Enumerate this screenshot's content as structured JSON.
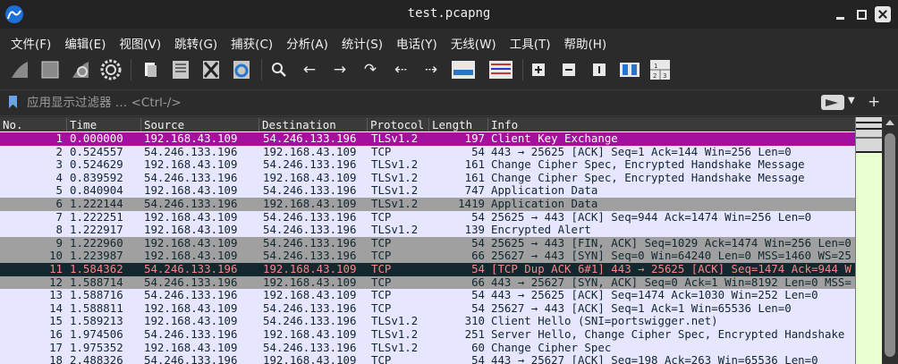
{
  "window": {
    "title": "test.pcapng"
  },
  "menu": [
    "文件(F)",
    "编辑(E)",
    "视图(V)",
    "跳转(G)",
    "捕获(C)",
    "分析(A)",
    "统计(S)",
    "电话(Y)",
    "无线(W)",
    "工具(T)",
    "帮助(H)"
  ],
  "filter": {
    "placeholder": "应用显示过滤器 … <Ctrl-/>"
  },
  "columns": [
    "No.",
    "Time",
    "Source",
    "Destination",
    "Protocol",
    "Length",
    "Info"
  ],
  "packets": [
    {
      "no": "1",
      "time": "0.000000",
      "src": "192.168.43.109",
      "dst": "54.246.133.196",
      "proto": "TLSv1.2",
      "len": "197",
      "info": "Client Key Exchange",
      "style": "sel"
    },
    {
      "no": "2",
      "time": "0.524557",
      "src": "54.246.133.196",
      "dst": "192.168.43.109",
      "proto": "TCP",
      "len": "54",
      "info": "443 → 25625 [ACK] Seq=1 Ack=144 Win=256 Len=0",
      "style": "tcp"
    },
    {
      "no": "3",
      "time": "0.524629",
      "src": "192.168.43.109",
      "dst": "54.246.133.196",
      "proto": "TLSv1.2",
      "len": "161",
      "info": "Change Cipher Spec, Encrypted Handshake Message",
      "style": "tls"
    },
    {
      "no": "4",
      "time": "0.839592",
      "src": "54.246.133.196",
      "dst": "192.168.43.109",
      "proto": "TLSv1.2",
      "len": "161",
      "info": "Change Cipher Spec, Encrypted Handshake Message",
      "style": "tls"
    },
    {
      "no": "5",
      "time": "0.840904",
      "src": "192.168.43.109",
      "dst": "54.246.133.196",
      "proto": "TLSv1.2",
      "len": "747",
      "info": "Application Data",
      "style": "tls"
    },
    {
      "no": "6",
      "time": "1.222144",
      "src": "54.246.133.196",
      "dst": "192.168.43.109",
      "proto": "TLSv1.2",
      "len": "1419",
      "info": "Application Data",
      "style": "gray"
    },
    {
      "no": "7",
      "time": "1.222251",
      "src": "192.168.43.109",
      "dst": "54.246.133.196",
      "proto": "TCP",
      "len": "54",
      "info": "25625 → 443 [ACK] Seq=944 Ack=1474 Win=256 Len=0",
      "style": "tcp"
    },
    {
      "no": "8",
      "time": "1.222917",
      "src": "192.168.43.109",
      "dst": "54.246.133.196",
      "proto": "TLSv1.2",
      "len": "139",
      "info": "Encrypted Alert",
      "style": "tls"
    },
    {
      "no": "9",
      "time": "1.222960",
      "src": "192.168.43.109",
      "dst": "54.246.133.196",
      "proto": "TCP",
      "len": "54",
      "info": "25625 → 443 [FIN, ACK] Seq=1029 Ack=1474 Win=256 Len=0",
      "style": "gray"
    },
    {
      "no": "10",
      "time": "1.223987",
      "src": "192.168.43.109",
      "dst": "54.246.133.196",
      "proto": "TCP",
      "len": "66",
      "info": "25627 → 443 [SYN] Seq=0 Win=64240 Len=0 MSS=1460 WS=25",
      "style": "gray"
    },
    {
      "no": "11",
      "time": "1.584362",
      "src": "54.246.133.196",
      "dst": "192.168.43.109",
      "proto": "TCP",
      "len": "54",
      "info": "[TCP Dup ACK 6#1] 443 → 25625 [ACK] Seq=1474 Ack=944 W",
      "style": "bad"
    },
    {
      "no": "12",
      "time": "1.588714",
      "src": "54.246.133.196",
      "dst": "192.168.43.109",
      "proto": "TCP",
      "len": "66",
      "info": "443 → 25627 [SYN, ACK] Seq=0 Ack=1 Win=8192 Len=0 MSS=",
      "style": "gray"
    },
    {
      "no": "13",
      "time": "1.588716",
      "src": "54.246.133.196",
      "dst": "192.168.43.109",
      "proto": "TCP",
      "len": "54",
      "info": "443 → 25625 [ACK] Seq=1474 Ack=1030 Win=252 Len=0",
      "style": "tcp"
    },
    {
      "no": "14",
      "time": "1.588811",
      "src": "192.168.43.109",
      "dst": "54.246.133.196",
      "proto": "TCP",
      "len": "54",
      "info": "25627 → 443 [ACK] Seq=1 Ack=1 Win=65536 Len=0",
      "style": "tcp"
    },
    {
      "no": "15",
      "time": "1.589213",
      "src": "192.168.43.109",
      "dst": "54.246.133.196",
      "proto": "TLSv1.2",
      "len": "310",
      "info": "Client Hello (SNI=portswigger.net)",
      "style": "tls"
    },
    {
      "no": "16",
      "time": "1.974506",
      "src": "54.246.133.196",
      "dst": "192.168.43.109",
      "proto": "TLSv1.2",
      "len": "251",
      "info": "Server Hello, Change Cipher Spec, Encrypted Handshake",
      "style": "tls"
    },
    {
      "no": "17",
      "time": "1.975352",
      "src": "192.168.43.109",
      "dst": "54.246.133.196",
      "proto": "TLSv1.2",
      "len": "60",
      "info": "Change Cipher Spec",
      "style": "tls"
    },
    {
      "no": "18",
      "time": "2.488326",
      "src": "54.246.133.196",
      "dst": "192.168.43.109",
      "proto": "TCP",
      "len": "54",
      "info": "443 → 25627 [ACK] Seq=198 Ack=263 Win=65536 Len=0",
      "style": "tcp"
    }
  ],
  "colors": {
    "selected": "#a40f9e",
    "normal": "#e7e6ff",
    "gray": "#a0a0a0",
    "bad_bg": "#12272e",
    "bad_fg": "#f78787"
  }
}
